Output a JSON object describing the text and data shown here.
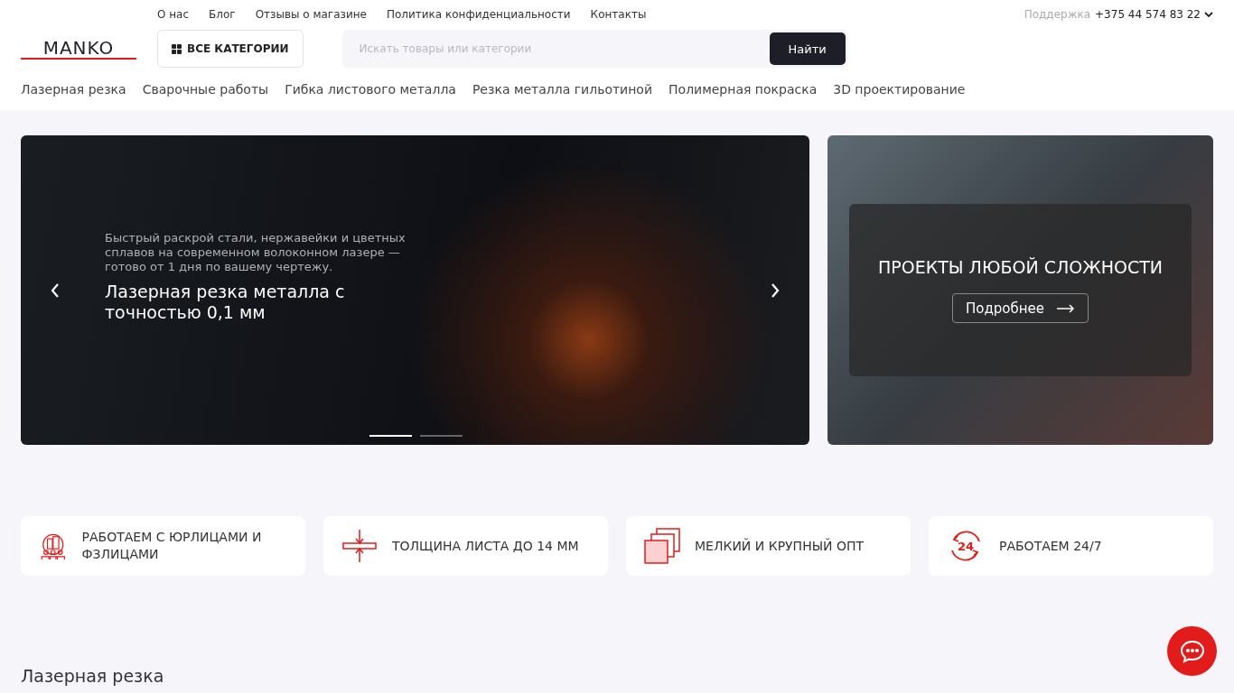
{
  "top_links": [
    "О нас",
    "Блог",
    "Отзывы о магазине",
    "Политика конфиденциальности",
    "Контакты"
  ],
  "support": {
    "label": "Поддержка",
    "phone": "+375 44 574 83 22"
  },
  "logo": "MANKO",
  "categories_button": "ВСЕ КАТЕГОРИИ",
  "search": {
    "placeholder": "Искать товары или категории",
    "button": "Найти"
  },
  "service_nav": [
    "Лазерная резка",
    "Сварочные работы",
    "Гибка листового металла",
    "Резка металла гильотиной",
    "Полимерная покраска",
    "3D проектирование"
  ],
  "hero": {
    "subtitle": "Быстрый раскрой стали, нержавейки и цветных сплавов на современном волоконном лазере — готово от 1 дня по вашему чертежу.",
    "title": "Лазерная резка металла с точностью 0,1 мм",
    "dots": [
      {
        "selected": true
      },
      {
        "selected": false
      }
    ]
  },
  "promo": {
    "title": "ПРОЕКТЫ ЛЮБОЙ СЛОЖНОСТИ",
    "button": "Подробнее"
  },
  "features": [
    {
      "kind": "people",
      "text": "РАБОТАЕМ С ЮРЛИЦАМИ И ФЗЛИЦАМИ"
    },
    {
      "kind": "thickness",
      "text": "ТОЛЩИНА ЛИСТА ДО 14 ММ"
    },
    {
      "kind": "sheets",
      "text": "МЕЛКИЙ И КРУПНЫЙ ОПТ"
    },
    {
      "kind": "clock",
      "text": "РАБОТАЕМ 24/7",
      "badge": "24"
    }
  ],
  "section_title": "Лазерная резка"
}
